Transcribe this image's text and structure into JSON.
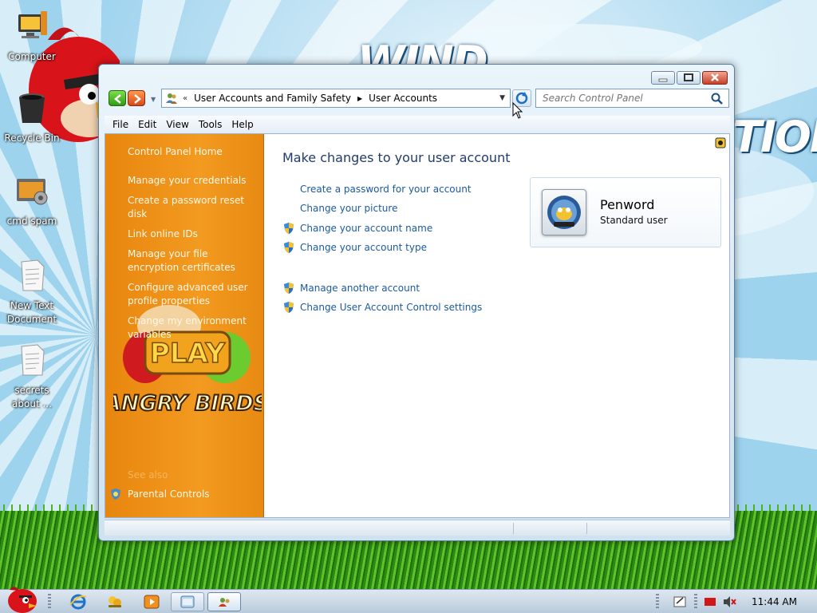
{
  "desktop": {
    "icons": [
      {
        "label": "Computer"
      },
      {
        "label": "Recycle Bin"
      },
      {
        "label": "cmd spam"
      },
      {
        "label": "New Text Document"
      },
      {
        "label": "secrets about ..."
      }
    ],
    "background_text": {
      "left": "WIND",
      "right": "TION"
    }
  },
  "window": {
    "address": {
      "crumbs": [
        "User Accounts and Family Safety",
        "User Accounts"
      ],
      "overflow_chevron": "«"
    },
    "search": {
      "placeholder": "Search Control Panel"
    },
    "menu": [
      "File",
      "Edit",
      "View",
      "Tools",
      "Help"
    ],
    "sidebar": {
      "links": [
        "Control Panel Home",
        "Manage your credentials",
        "Create a password reset disk",
        "Link online IDs",
        "Manage your file encryption certificates",
        "Configure advanced user profile properties",
        "Change my environment variables"
      ],
      "see_also_label": "See also",
      "see_also_links": [
        "Parental Controls"
      ],
      "art": {
        "play_label": "PLAY",
        "logo_label": "ANGRY BIRDS"
      }
    },
    "main": {
      "title": "Make changes to your user account",
      "tasks_primary": [
        {
          "label": "Create a password for your account",
          "shield": false
        },
        {
          "label": "Change your picture",
          "shield": false
        },
        {
          "label": "Change your account name",
          "shield": true
        },
        {
          "label": "Change your account type",
          "shield": true
        }
      ],
      "tasks_secondary": [
        {
          "label": "Manage another account",
          "shield": true
        },
        {
          "label": "Change User Account Control settings",
          "shield": true
        }
      ],
      "user": {
        "name": "Penword",
        "role": "Standard user"
      }
    }
  },
  "taskbar": {
    "clock": "11:44 AM",
    "pinned": [
      "angry-birds-start",
      "internet-explorer",
      "messenger",
      "media-player",
      "explorer-window",
      "control-panel-window"
    ]
  },
  "colors": {
    "sidebar_orange": "#f08e17",
    "link_blue": "#1a5a9e",
    "title_blue": "#1e3c6e"
  }
}
